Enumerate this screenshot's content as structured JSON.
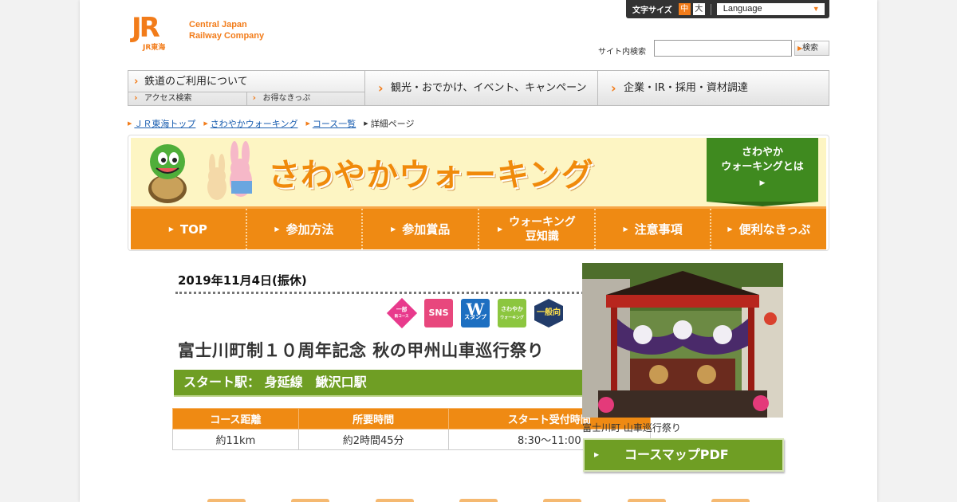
{
  "header": {
    "logo_mark": "JR",
    "logo_sub": "JR東海",
    "logo_text_line1": "Central Japan",
    "logo_text_line2": "Railway Company",
    "font_size_label": "文字サイズ",
    "font_size_mid": "中",
    "font_size_big": "大",
    "language_label": "Language",
    "search_label": "サイト内検索",
    "search_button": "検索",
    "search_value": ""
  },
  "global_nav": {
    "railway": "鉄道のご利用について",
    "access": "アクセス検索",
    "tickets": "お得なきっぷ",
    "sightseeing": "観光・おでかけ、イベント、キャンペーン",
    "corporate": "企業・IR・採用・資材調達"
  },
  "breadcrumb": [
    "ＪＲ東海トップ",
    "さわやかウォーキング",
    "コース一覧",
    "詳細ページ"
  ],
  "banner": {
    "title": "さわやかウォーキング",
    "about_line1": "さわやか",
    "about_line2": "ウォーキングとは",
    "nav": [
      "TOP",
      "参加方法",
      "参加賞品",
      "ウォーキング",
      "豆知識",
      "注意事項",
      "便利なきっぷ"
    ]
  },
  "event": {
    "date": "2019年11月4日(振休)",
    "badges": {
      "partial": "一部",
      "partial_sub": "新コース",
      "sns": "SNS",
      "w": "W",
      "w_sub": "スタンプ",
      "gun": "さわやか",
      "gun_sub": "ウォーキング",
      "general": "一般向"
    },
    "title": "富士川町制１０周年記念 秋の甲州山車巡行祭り",
    "start_station": "スタート駅：  身延線　鰍沢口駅",
    "table_headers": [
      "コース距離",
      "所要時間",
      "スタート受付時間"
    ],
    "table_values": [
      "約11km",
      "約2時間45分",
      "8:30～11:00"
    ],
    "photo_caption": "富士川町 山車巡行祭り",
    "pdf_button": "コースマップPDF"
  },
  "colors": {
    "accent_orange": "#ef8a13",
    "accent_green": "#6f9e24",
    "link_blue": "#1a5eb0"
  }
}
